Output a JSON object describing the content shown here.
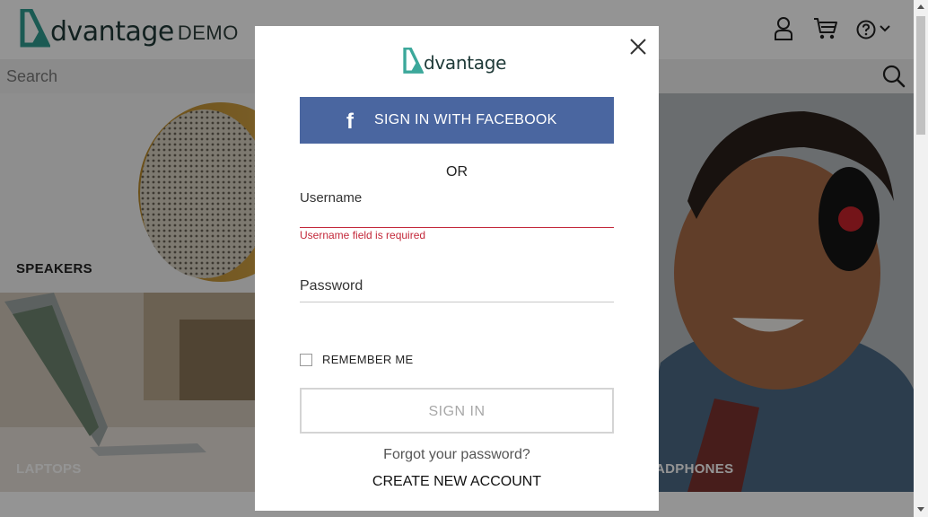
{
  "header": {
    "logo_text": "dvantage",
    "logo_demo": "DEMO",
    "icons": [
      "user-icon",
      "cart-icon",
      "help-icon",
      "chevron-down-icon"
    ]
  },
  "search": {
    "placeholder": "Search"
  },
  "tiles": {
    "speakers": "SPEAKERS",
    "laptops": "LAPTOPS",
    "headphones": "ADPHONES"
  },
  "modal": {
    "logo_text": "dvantage",
    "facebook_label": "SIGN IN WITH FACEBOOK",
    "facebook_icon": "f",
    "or_text": "OR",
    "username_label": "Username",
    "username_value": "",
    "username_error": "Username field is required",
    "password_label": "Password",
    "password_value": "",
    "remember_label": "REMEMBER ME",
    "remember_checked": false,
    "signin_label": "SIGN IN",
    "forgot_label": "Forgot your password?",
    "create_label": "CREATE NEW ACCOUNT"
  },
  "colors": {
    "brand_teal": "#3ca89b",
    "facebook_blue": "#4a66a0",
    "error_red": "#c3283a",
    "overlay": "rgba(0,0,0,0.42)"
  }
}
